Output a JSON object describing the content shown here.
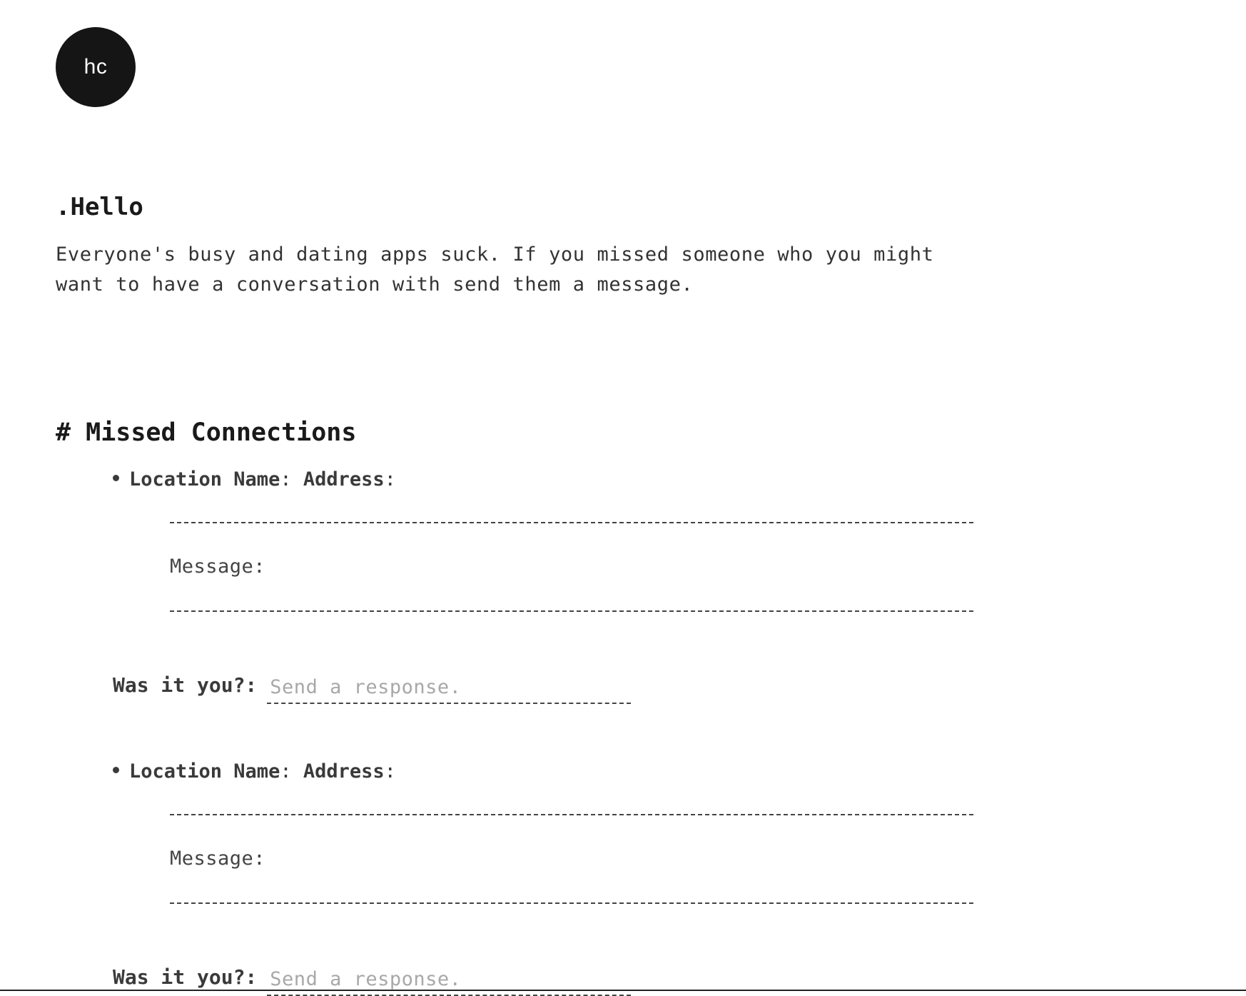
{
  "logo": {
    "text": "hc"
  },
  "intro": {
    "title": ".Hello",
    "body": "Everyone's busy and dating apps suck. If you missed someone who you might want to have a conversation with send them a message."
  },
  "missed_connections": {
    "title": "# Missed Connections",
    "entries": [
      {
        "location_label": "Location Name",
        "address_label": "Address",
        "message_label": "Message:",
        "response_label": "Was it you?:",
        "response_placeholder": "Send a response."
      },
      {
        "location_label": "Location Name",
        "address_label": "Address",
        "message_label": "Message:",
        "response_label": "Was it you?:",
        "response_placeholder": "Send a response."
      }
    ]
  }
}
